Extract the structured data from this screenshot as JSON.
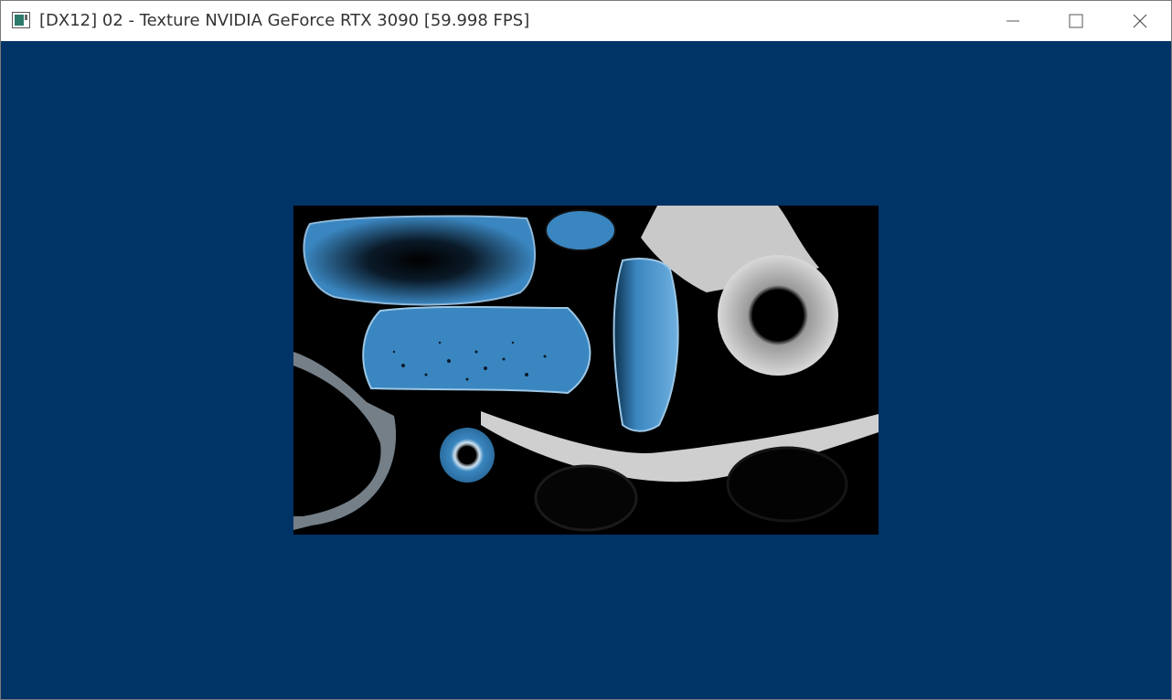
{
  "window": {
    "title": "[DX12] 02 - Texture NVIDIA GeForce RTX 3090 [59.998 FPS]",
    "icons": {
      "app": "app-window-icon",
      "minimize": "minimize-icon",
      "maximize": "maximize-icon",
      "close": "close-icon"
    }
  },
  "viewport": {
    "clear_color": "#003366",
    "texture": {
      "description_color_blue": "#3a86c0",
      "background": "#000000"
    }
  }
}
